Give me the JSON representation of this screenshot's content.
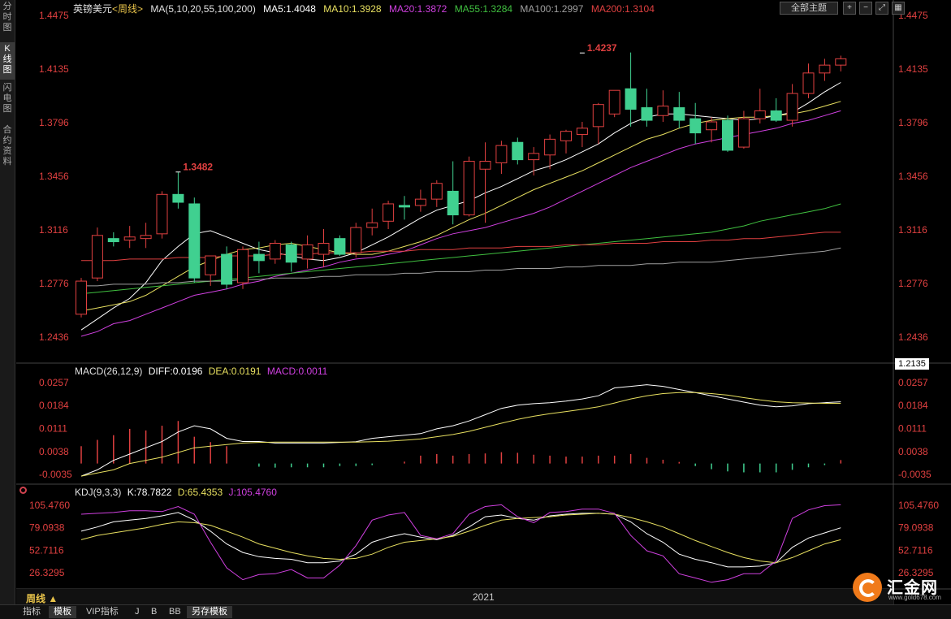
{
  "left_tabs": [
    {
      "label": "分时图",
      "active": false
    },
    {
      "label": "K线图",
      "active": true
    },
    {
      "label": "闪电图",
      "active": false
    },
    {
      "label": "合约资料",
      "active": false
    }
  ],
  "header": {
    "symbol": "英镑美元",
    "period": "<周线>",
    "ma_label": "MA(5,10,20,55,100,200)",
    "ma": [
      {
        "text": "MA5:1.4048",
        "color": "#ffffff"
      },
      {
        "text": "MA10:1.3928",
        "color": "#e8e060"
      },
      {
        "text": "MA20:1.3872",
        "color": "#d040e0"
      },
      {
        "text": "MA55:1.3284",
        "color": "#40c040"
      },
      {
        "text": "MA100:1.2997",
        "color": "#a0a0a0"
      },
      {
        "text": "MA200:1.3104",
        "color": "#e04040"
      }
    ],
    "theme_button": "全部主题",
    "tool_icons": [
      "zoom-in-icon",
      "zoom-out-icon",
      "expand-icon",
      "grid-icon"
    ]
  },
  "last_price": "1.2135",
  "macd_header": {
    "label": "MACD(26,12,9)",
    "diff": "DIFF:0.0196",
    "dea": "DEA:0.0191",
    "macd": "MACD:0.0011"
  },
  "kdj_header": {
    "label": "KDJ(9,3,3)",
    "k": "K:78.7822",
    "d": "D:65.4353",
    "j": "J:105.4760"
  },
  "period_label": "周线 ▲",
  "year_label": "2021",
  "bottom_tabs": [
    {
      "label": "指标",
      "active": false
    },
    {
      "label": "模板",
      "active": true
    },
    {
      "label": "VIP指标",
      "active": false
    },
    {
      "label": "J",
      "active": false
    },
    {
      "label": "B",
      "active": false
    },
    {
      "label": "BB",
      "active": false
    },
    {
      "label": "另存模板",
      "active": true
    }
  ],
  "logo": {
    "text": "汇金网",
    "url": "www.gold678.com"
  },
  "colors": {
    "up": "#e04040",
    "down": "#40d090",
    "ma5": "#ffffff",
    "ma10": "#e8e060",
    "ma20": "#d040e0",
    "ma55": "#40c040",
    "ma100": "#a0a0a0",
    "ma200": "#e04040"
  },
  "chart_data": [
    {
      "type": "candlestick",
      "title": "英镑美元 周线",
      "y_ticks": [
        "1.4475",
        "1.4135",
        "1.3796",
        "1.3456",
        "1.3116",
        "1.2776",
        "1.2436"
      ],
      "ylim": [
        1.227,
        1.4475
      ],
      "high_annotations": [
        {
          "index": 6,
          "label": "1.3482",
          "value": 1.3482
        },
        {
          "index": 31,
          "label": "1.4237",
          "value": 1.4237
        }
      ],
      "candles": [
        {
          "o": 1.258,
          "h": 1.281,
          "l": 1.256,
          "c": 1.279
        },
        {
          "o": 1.281,
          "h": 1.313,
          "l": 1.279,
          "c": 1.308
        },
        {
          "o": 1.306,
          "h": 1.31,
          "l": 1.301,
          "c": 1.304
        },
        {
          "o": 1.305,
          "h": 1.314,
          "l": 1.3,
          "c": 1.307
        },
        {
          "o": 1.306,
          "h": 1.316,
          "l": 1.3,
          "c": 1.308
        },
        {
          "o": 1.309,
          "h": 1.336,
          "l": 1.306,
          "c": 1.334
        },
        {
          "o": 1.334,
          "h": 1.348,
          "l": 1.325,
          "c": 1.329
        },
        {
          "o": 1.328,
          "h": 1.332,
          "l": 1.278,
          "c": 1.281
        },
        {
          "o": 1.283,
          "h": 1.295,
          "l": 1.276,
          "c": 1.295
        },
        {
          "o": 1.296,
          "h": 1.301,
          "l": 1.274,
          "c": 1.277
        },
        {
          "o": 1.278,
          "h": 1.301,
          "l": 1.274,
          "c": 1.299
        },
        {
          "o": 1.296,
          "h": 1.304,
          "l": 1.284,
          "c": 1.292
        },
        {
          "o": 1.293,
          "h": 1.305,
          "l": 1.29,
          "c": 1.303
        },
        {
          "o": 1.302,
          "h": 1.304,
          "l": 1.285,
          "c": 1.291
        },
        {
          "o": 1.293,
          "h": 1.308,
          "l": 1.287,
          "c": 1.302
        },
        {
          "o": 1.296,
          "h": 1.312,
          "l": 1.288,
          "c": 1.303
        },
        {
          "o": 1.306,
          "h": 1.308,
          "l": 1.295,
          "c": 1.296
        },
        {
          "o": 1.297,
          "h": 1.316,
          "l": 1.294,
          "c": 1.313
        },
        {
          "o": 1.313,
          "h": 1.325,
          "l": 1.308,
          "c": 1.316
        },
        {
          "o": 1.317,
          "h": 1.33,
          "l": 1.312,
          "c": 1.328
        },
        {
          "o": 1.327,
          "h": 1.333,
          "l": 1.318,
          "c": 1.326
        },
        {
          "o": 1.327,
          "h": 1.337,
          "l": 1.323,
          "c": 1.331
        },
        {
          "o": 1.331,
          "h": 1.343,
          "l": 1.326,
          "c": 1.341
        },
        {
          "o": 1.336,
          "h": 1.355,
          "l": 1.315,
          "c": 1.321
        },
        {
          "o": 1.321,
          "h": 1.358,
          "l": 1.32,
          "c": 1.355
        },
        {
          "o": 1.35,
          "h": 1.367,
          "l": 1.316,
          "c": 1.355
        },
        {
          "o": 1.354,
          "h": 1.368,
          "l": 1.347,
          "c": 1.365
        },
        {
          "o": 1.367,
          "h": 1.37,
          "l": 1.353,
          "c": 1.356
        },
        {
          "o": 1.356,
          "h": 1.364,
          "l": 1.346,
          "c": 1.36
        },
        {
          "o": 1.359,
          "h": 1.372,
          "l": 1.35,
          "c": 1.369
        },
        {
          "o": 1.368,
          "h": 1.375,
          "l": 1.36,
          "c": 1.374
        },
        {
          "o": 1.372,
          "h": 1.38,
          "l": 1.364,
          "c": 1.376
        },
        {
          "o": 1.377,
          "h": 1.392,
          "l": 1.366,
          "c": 1.391
        },
        {
          "o": 1.385,
          "h": 1.4,
          "l": 1.383,
          "c": 1.4
        },
        {
          "o": 1.401,
          "h": 1.424,
          "l": 1.377,
          "c": 1.388
        },
        {
          "o": 1.389,
          "h": 1.401,
          "l": 1.377,
          "c": 1.381
        },
        {
          "o": 1.384,
          "h": 1.4,
          "l": 1.38,
          "c": 1.39
        },
        {
          "o": 1.389,
          "h": 1.399,
          "l": 1.376,
          "c": 1.381
        },
        {
          "o": 1.382,
          "h": 1.392,
          "l": 1.366,
          "c": 1.373
        },
        {
          "o": 1.375,
          "h": 1.383,
          "l": 1.367,
          "c": 1.38
        },
        {
          "o": 1.381,
          "h": 1.384,
          "l": 1.361,
          "c": 1.362
        },
        {
          "o": 1.364,
          "h": 1.387,
          "l": 1.363,
          "c": 1.382
        },
        {
          "o": 1.382,
          "h": 1.401,
          "l": 1.379,
          "c": 1.387
        },
        {
          "o": 1.387,
          "h": 1.395,
          "l": 1.38,
          "c": 1.381
        },
        {
          "o": 1.381,
          "h": 1.404,
          "l": 1.377,
          "c": 1.398
        },
        {
          "o": 1.398,
          "h": 1.417,
          "l": 1.395,
          "c": 1.411
        },
        {
          "o": 1.411,
          "h": 1.42,
          "l": 1.406,
          "c": 1.416
        },
        {
          "o": 1.416,
          "h": 1.422,
          "l": 1.412,
          "c": 1.42
        }
      ],
      "ma_series": [
        {
          "name": "MA5",
          "values": [
            1.248,
            1.255,
            1.262,
            1.268,
            1.278,
            1.292,
            1.301,
            1.309,
            1.311,
            1.307,
            1.303,
            1.299,
            1.297,
            1.295,
            1.293,
            1.292,
            1.294,
            1.297,
            1.302,
            1.307,
            1.313,
            1.319,
            1.324,
            1.327,
            1.33,
            1.335,
            1.339,
            1.344,
            1.349,
            1.352,
            1.356,
            1.361,
            1.366,
            1.373,
            1.379,
            1.383,
            1.385,
            1.385,
            1.384,
            1.383,
            1.382,
            1.381,
            1.382,
            1.384,
            1.386,
            1.392,
            1.399,
            1.405
          ]
        },
        {
          "name": "MA10",
          "values": [
            1.26,
            1.262,
            1.264,
            1.266,
            1.27,
            1.276,
            1.282,
            1.288,
            1.292,
            1.296,
            1.299,
            1.3,
            1.302,
            1.303,
            1.301,
            1.299,
            1.297,
            1.296,
            1.296,
            1.298,
            1.301,
            1.304,
            1.308,
            1.313,
            1.318,
            1.322,
            1.327,
            1.332,
            1.337,
            1.341,
            1.345,
            1.349,
            1.354,
            1.359,
            1.364,
            1.369,
            1.372,
            1.376,
            1.379,
            1.381,
            1.382,
            1.383,
            1.383,
            1.384,
            1.385,
            1.387,
            1.39,
            1.393
          ]
        },
        {
          "name": "MA20",
          "values": [
            1.244,
            1.247,
            1.252,
            1.254,
            1.258,
            1.262,
            1.266,
            1.27,
            1.272,
            1.274,
            1.277,
            1.279,
            1.282,
            1.284,
            1.286,
            1.288,
            1.291,
            1.293,
            1.294,
            1.296,
            1.298,
            1.302,
            1.306,
            1.309,
            1.311,
            1.313,
            1.316,
            1.319,
            1.322,
            1.326,
            1.331,
            1.336,
            1.341,
            1.346,
            1.351,
            1.355,
            1.359,
            1.363,
            1.366,
            1.368,
            1.37,
            1.372,
            1.374,
            1.376,
            1.379,
            1.381,
            1.384,
            1.387
          ]
        },
        {
          "name": "MA55",
          "values": [
            1.271,
            1.272,
            1.273,
            1.274,
            1.275,
            1.276,
            1.277,
            1.278,
            1.279,
            1.28,
            1.281,
            1.282,
            1.283,
            1.284,
            1.285,
            1.286,
            1.287,
            1.288,
            1.289,
            1.29,
            1.291,
            1.292,
            1.293,
            1.294,
            1.295,
            1.296,
            1.297,
            1.298,
            1.299,
            1.3,
            1.301,
            1.302,
            1.303,
            1.304,
            1.305,
            1.306,
            1.307,
            1.308,
            1.309,
            1.31,
            1.312,
            1.314,
            1.317,
            1.319,
            1.321,
            1.323,
            1.325,
            1.328
          ]
        },
        {
          "name": "MA100",
          "values": [
            1.276,
            1.276,
            1.277,
            1.277,
            1.277,
            1.278,
            1.278,
            1.279,
            1.279,
            1.279,
            1.28,
            1.28,
            1.281,
            1.281,
            1.281,
            1.282,
            1.282,
            1.283,
            1.283,
            1.283,
            1.284,
            1.284,
            1.285,
            1.285,
            1.285,
            1.286,
            1.286,
            1.287,
            1.287,
            1.287,
            1.288,
            1.288,
            1.289,
            1.289,
            1.289,
            1.29,
            1.29,
            1.291,
            1.291,
            1.291,
            1.292,
            1.293,
            1.294,
            1.295,
            1.296,
            1.297,
            1.298,
            1.3
          ]
        },
        {
          "name": "MA200",
          "values": [
            1.292,
            1.292,
            1.292,
            1.293,
            1.293,
            1.293,
            1.294,
            1.294,
            1.294,
            1.295,
            1.295,
            1.295,
            1.296,
            1.296,
            1.296,
            1.297,
            1.297,
            1.297,
            1.298,
            1.298,
            1.298,
            1.299,
            1.299,
            1.299,
            1.3,
            1.3,
            1.3,
            1.301,
            1.301,
            1.301,
            1.302,
            1.302,
            1.302,
            1.303,
            1.303,
            1.303,
            1.304,
            1.304,
            1.304,
            1.305,
            1.305,
            1.306,
            1.306,
            1.307,
            1.308,
            1.309,
            1.31,
            1.31
          ]
        }
      ]
    },
    {
      "type": "bar",
      "title": "MACD(26,12,9)",
      "y_ticks": [
        "0.0257",
        "0.0184",
        "0.0111",
        "0.0038",
        "-0.0035"
      ],
      "ylim": [
        -0.005,
        0.028
      ],
      "histogram": [
        0.0055,
        0.0075,
        0.009,
        0.011,
        0.0105,
        0.012,
        0.0135,
        0.0085,
        0.0068,
        0.0055,
        0.0,
        -0.001,
        -0.0013,
        -0.0012,
        -0.0012,
        -0.0012,
        -0.0008,
        -0.0008,
        -0.0005,
        -0.0,
        0.0006,
        0.0025,
        0.003,
        0.0025,
        0.003,
        0.0032,
        0.0036,
        0.0034,
        0.0028,
        0.0025,
        0.0022,
        0.0022,
        0.0025,
        0.0025,
        0.003,
        0.0018,
        0.0012,
        0.0005,
        -0.0008,
        -0.0018,
        -0.0025,
        -0.0028,
        -0.0028,
        -0.0028,
        -0.002,
        -0.0012,
        -0.0005,
        0.0011
      ],
      "series": [
        {
          "name": "DIFF",
          "values": [
            -0.004,
            -0.002,
            0.001,
            0.003,
            0.005,
            0.007,
            0.01,
            0.012,
            0.011,
            0.008,
            0.007,
            0.007,
            0.0065,
            0.0065,
            0.0065,
            0.0065,
            0.0067,
            0.0069,
            0.008,
            0.0085,
            0.009,
            0.0095,
            0.011,
            0.012,
            0.0135,
            0.0155,
            0.0175,
            0.0185,
            0.019,
            0.0193,
            0.0198,
            0.0205,
            0.0215,
            0.024,
            0.0245,
            0.025,
            0.0245,
            0.0235,
            0.0225,
            0.0215,
            0.0205,
            0.0195,
            0.0185,
            0.018,
            0.0183,
            0.019,
            0.0193,
            0.0196
          ]
        },
        {
          "name": "DEA",
          "values": [
            -0.004,
            -0.003,
            -0.002,
            0.0,
            0.001,
            0.002,
            0.0035,
            0.005,
            0.0055,
            0.006,
            0.0065,
            0.0067,
            0.0068,
            0.0068,
            0.0068,
            0.0068,
            0.0068,
            0.0068,
            0.0069,
            0.0071,
            0.0074,
            0.0078,
            0.0085,
            0.0092,
            0.0102,
            0.0115,
            0.0128,
            0.014,
            0.015,
            0.0158,
            0.0165,
            0.0172,
            0.018,
            0.0192,
            0.0205,
            0.0215,
            0.0222,
            0.0225,
            0.0225,
            0.0222,
            0.0217,
            0.0209,
            0.0202,
            0.0196,
            0.0193,
            0.0192,
            0.0191,
            0.0191
          ]
        }
      ]
    },
    {
      "type": "line",
      "title": "KDJ(9,3,3)",
      "y_ticks": [
        "105.4760",
        "79.0938",
        "52.7116",
        "26.3295"
      ],
      "ylim": [
        10,
        115
      ],
      "series": [
        {
          "name": "K",
          "values": [
            75,
            80,
            86,
            88,
            90,
            93,
            97,
            88,
            75,
            60,
            50,
            45,
            43,
            42,
            38,
            38,
            40,
            48,
            62,
            68,
            72,
            68,
            65,
            70,
            80,
            92,
            94,
            90,
            88,
            93,
            95,
            96,
            96,
            95,
            86,
            72,
            62,
            48,
            42,
            38,
            33,
            33,
            34,
            38,
            56,
            67,
            73,
            79
          ]
        },
        {
          "name": "D",
          "values": [
            65,
            70,
            73,
            76,
            79,
            83,
            86,
            85,
            82,
            75,
            68,
            60,
            55,
            50,
            46,
            43,
            42,
            43,
            48,
            56,
            62,
            64,
            66,
            69,
            75,
            82,
            88,
            90,
            91,
            92,
            94,
            95,
            96,
            95,
            91,
            86,
            80,
            72,
            64,
            57,
            50,
            44,
            40,
            38,
            44,
            52,
            60,
            65
          ]
        },
        {
          "name": "J",
          "values": [
            95,
            96,
            97,
            99,
            99,
            98,
            104,
            95,
            62,
            32,
            18,
            24,
            25,
            30,
            20,
            20,
            35,
            58,
            88,
            94,
            97,
            70,
            66,
            72,
            95,
            104,
            106,
            92,
            85,
            97,
            98,
            101,
            101,
            96,
            70,
            52,
            46,
            25,
            20,
            15,
            18,
            25,
            25,
            40,
            90,
            100,
            105,
            106
          ]
        }
      ]
    }
  ]
}
